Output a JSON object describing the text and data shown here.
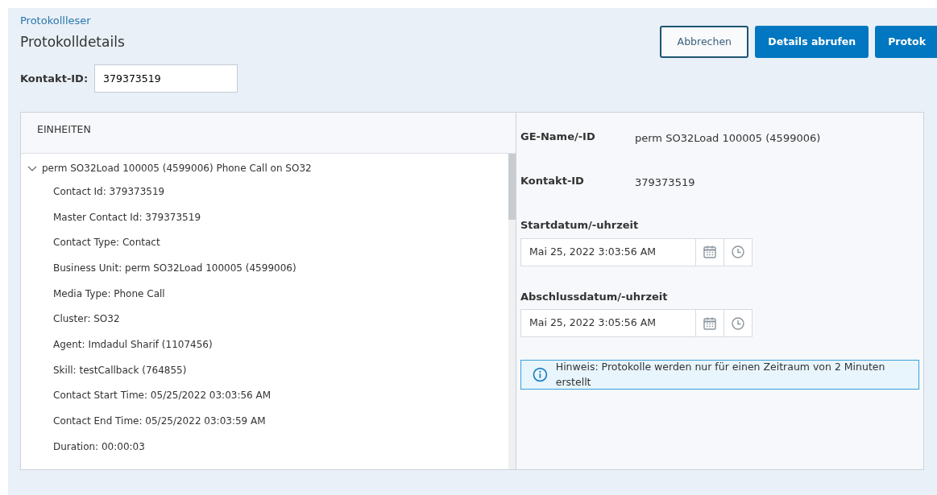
{
  "breadcrumb": "Protokollleser",
  "page_title": "Protokolldetails",
  "buttons": [
    {
      "label": "Abbrechen",
      "kind": "outline"
    },
    {
      "label": "Details abrufen",
      "kind": "primary"
    },
    {
      "label": "Protok",
      "kind": "primary"
    }
  ],
  "contact_field": {
    "label": "Kontakt-ID:",
    "value": "379373519"
  },
  "units_panel": {
    "title": "EINHEITEN",
    "tree": [
      {
        "label": "perm SO32Load 100005 (4599006) Phone Call on SO32",
        "expanded": true,
        "children": [
          {
            "label": "Contact Id: 379373519"
          },
          {
            "label": "Master Contact Id: 379373519"
          },
          {
            "label": "Contact Type: Contact"
          },
          {
            "label": "Business Unit: perm SO32Load 100005 (4599006)"
          },
          {
            "label": "Media Type: Phone Call"
          },
          {
            "label": "Cluster: SO32"
          },
          {
            "label": "Agent: Imdadul Sharif (1107456)"
          },
          {
            "label": "Skill: testCallback (764855)"
          },
          {
            "label": "Contact Start Time: 05/25/2022 03:03:56 AM"
          },
          {
            "label": "Contact End Time: 05/25/2022 03:03:59 AM"
          },
          {
            "label": "Duration: 00:00:03"
          }
        ]
      }
    ]
  },
  "details": [
    {
      "label": "GE-Name/-ID",
      "value": "perm SO32Load 100005 (4599006)"
    },
    {
      "label": "Kontakt-ID",
      "value": "379373519"
    }
  ],
  "datetimes": [
    {
      "label": "Startdatum/-uhrzeit",
      "value": "Mai 25, 2022 3:03:56 AM"
    },
    {
      "label": "Abschlussdatum/-uhrzeit",
      "value": "Mai 25, 2022 3:05:56 AM"
    }
  ],
  "notice": "Hinweis: Protokolle werden nur für einen Zeitraum von 2 Minuten erstellt"
}
